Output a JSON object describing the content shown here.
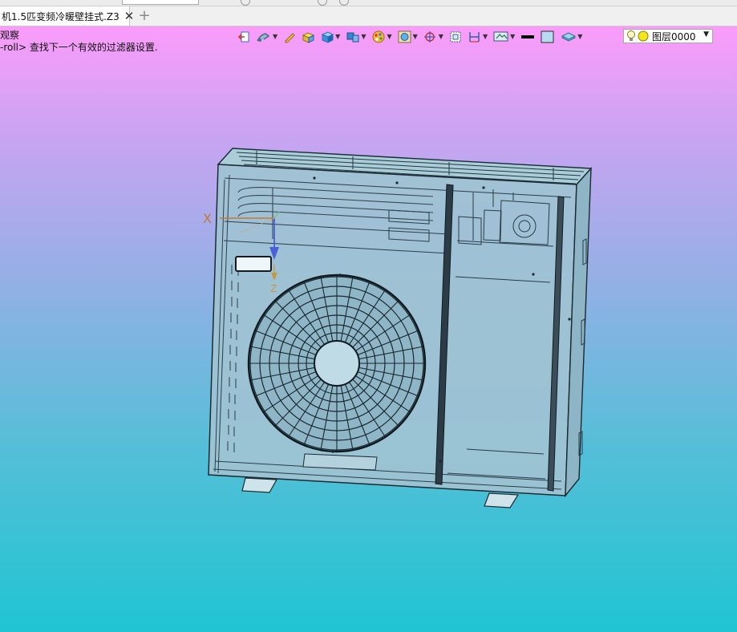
{
  "window": {
    "tab_title": "机1.5匹变频冷暖壁挂式.Z3",
    "close_glyph": "✕",
    "add_tab_glyph": "+"
  },
  "prompt": {
    "line1": "观察",
    "line2": "-roll> 查找下一个有效的过滤器设置."
  },
  "toolbar": {
    "layer_name": "图层0000",
    "items": [
      "exit-icon",
      "filter-icon",
      "pencil-icon",
      "solid-box-icon",
      "box-shading-icon",
      "part-icon",
      "palette-icon",
      "view-fit-icon",
      "snap-target-icon",
      "frame-icon",
      "dimension-icon",
      "display-mode-icon",
      "line-color-icon",
      "fill-color-icon",
      "layer-visibility-icon",
      "bulb-icon",
      "layer-state-icon"
    ],
    "colors": {
      "line_color": "#000000",
      "fill_color": "#b7dcf2"
    }
  },
  "viewport": {
    "gradient_top": "#fb9cfa",
    "gradient_bottom": "#1fc5d3",
    "triad": {
      "x_label": "X",
      "z_label": "Z",
      "x_color": "#c07a3a",
      "z_color": "#c49a4a",
      "y_color": "#4c5fd6"
    },
    "model": "outdoor-ac-unit",
    "model_color": "#9fc3d3"
  }
}
